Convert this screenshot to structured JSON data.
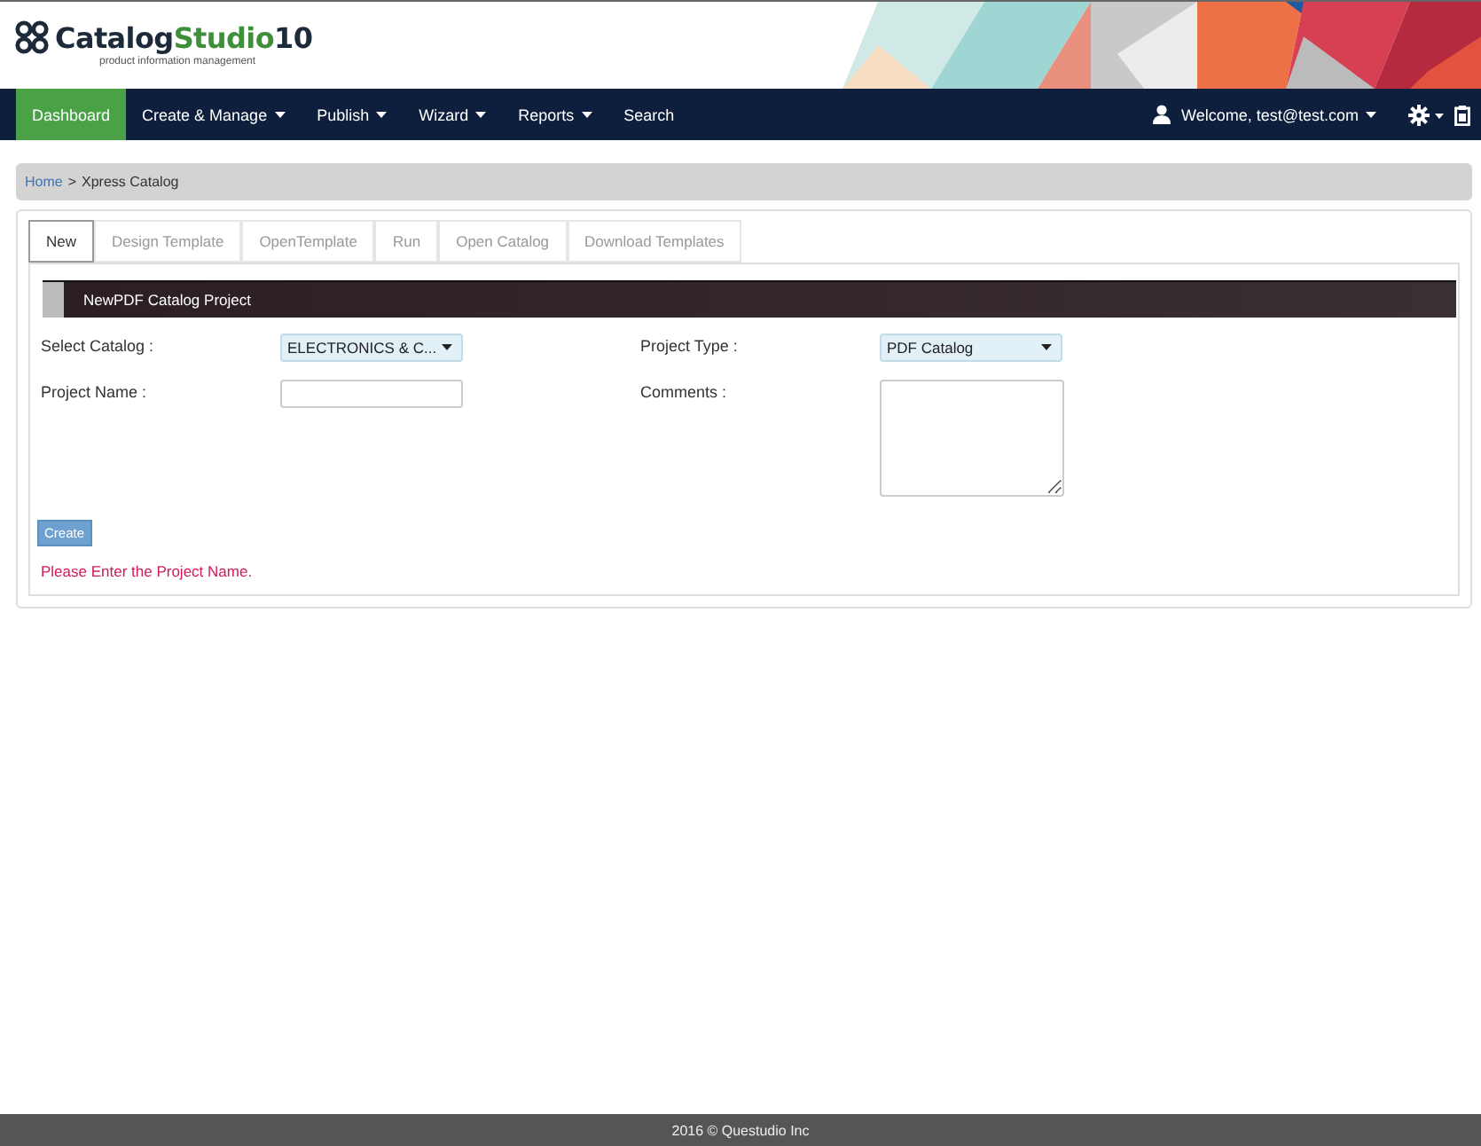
{
  "logo": {
    "name": "Catalog",
    "accent": "Studio",
    "version": "10",
    "tagline": "product information management"
  },
  "nav": {
    "items": [
      {
        "label": "Dashboard",
        "selected": true,
        "dropdown": false
      },
      {
        "label": "Create & Manage",
        "selected": false,
        "dropdown": true
      },
      {
        "label": "Publish",
        "selected": false,
        "dropdown": true
      },
      {
        "label": "Wizard",
        "selected": false,
        "dropdown": true
      },
      {
        "label": "Reports",
        "selected": false,
        "dropdown": true
      },
      {
        "label": "Search",
        "selected": false,
        "dropdown": false
      }
    ],
    "user": "Welcome, test@test.com"
  },
  "breadcrumb": {
    "link": "Home",
    "separator": ">",
    "current": "Xpress Catalog"
  },
  "tabs": [
    {
      "label": "New",
      "selected": true
    },
    {
      "label": "Design Template",
      "selected": false
    },
    {
      "label": "OpenTemplate",
      "selected": false
    },
    {
      "label": "Run",
      "selected": false
    },
    {
      "label": "Open Catalog",
      "selected": false
    },
    {
      "label": "Download Templates",
      "selected": false
    }
  ],
  "section_title": "NewPDF Catalog Project",
  "form": {
    "select_catalog": {
      "label": "Select Catalog :",
      "value": "ELECTRONICS & C..."
    },
    "project_type": {
      "label": "Project Type :",
      "value": "PDF Catalog"
    },
    "project_name": {
      "label": "Project Name :"
    },
    "comments": {
      "label": "Comments :"
    }
  },
  "create_button": "Create",
  "error_message": "Please Enter the Project Name.",
  "footer": "2016 © Questudio Inc"
}
